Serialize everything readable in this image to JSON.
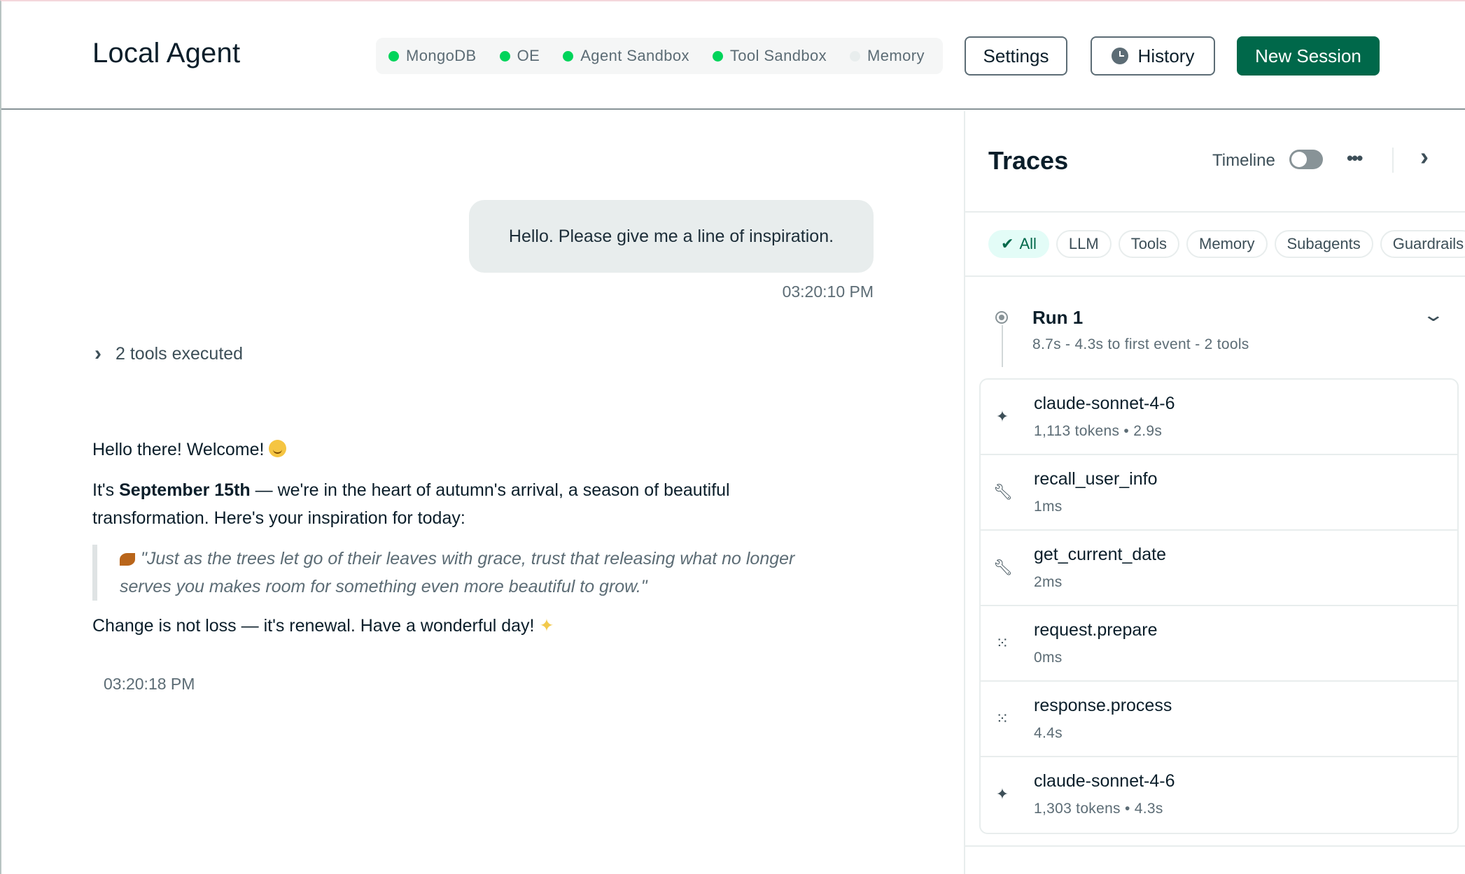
{
  "header": {
    "title": "Local Agent",
    "services": [
      {
        "label": "MongoDB",
        "color": "#00d45a"
      },
      {
        "label": "OE",
        "color": "#00d45a"
      },
      {
        "label": "Agent Sandbox",
        "color": "#00d45a"
      },
      {
        "label": "Tool Sandbox",
        "color": "#00d45a"
      },
      {
        "label": "Memory",
        "color": "#e8eded"
      }
    ],
    "settings_label": "Settings",
    "history_label": "History",
    "new_session_label": "New Session"
  },
  "chat": {
    "user_message": "Hello. Please give me a line of inspiration.",
    "user_time": "03:20:10 PM",
    "tools_executed": "2 tools executed",
    "reply_greeting": "Hello there! Welcome!",
    "reply_p2_prefix": "It's ",
    "reply_p2_bold": "September 15th",
    "reply_p2_rest": " — we're in the heart of autumn's arrival, a season of beautiful transformation. Here's your inspiration for today:",
    "reply_quote": "\"Just as the trees let go of their leaves with grace, trust that releasing what no longer serves you makes room for something even more beautiful to grow.\"",
    "reply_closing": "Change is not loss — it's renewal. Have a wonderful day!",
    "reply_time": "03:20:18 PM"
  },
  "traces": {
    "title": "Traces",
    "timeline_label": "Timeline",
    "timeline_on": false,
    "filters": [
      "All",
      "LLM",
      "Tools",
      "Memory",
      "Subagents",
      "Guardrails"
    ],
    "active_filter": "All",
    "run": {
      "title": "Run 1",
      "meta": "8.7s - 4.3s to first event - 2 tools"
    },
    "items": [
      {
        "icon": "sparkle-icon",
        "name": "claude-sonnet-4-6",
        "meta": "1,113 tokens • 2.9s"
      },
      {
        "icon": "wrench-icon",
        "name": "recall_user_info",
        "meta": "1ms"
      },
      {
        "icon": "wrench-icon",
        "name": "get_current_date",
        "meta": "2ms"
      },
      {
        "icon": "process-icon",
        "name": "request.prepare",
        "meta": "0ms"
      },
      {
        "icon": "process-icon",
        "name": "response.process",
        "meta": "4.4s"
      },
      {
        "icon": "sparkle-icon",
        "name": "claude-sonnet-4-6",
        "meta": "1,303 tokens • 4.3s"
      }
    ]
  }
}
